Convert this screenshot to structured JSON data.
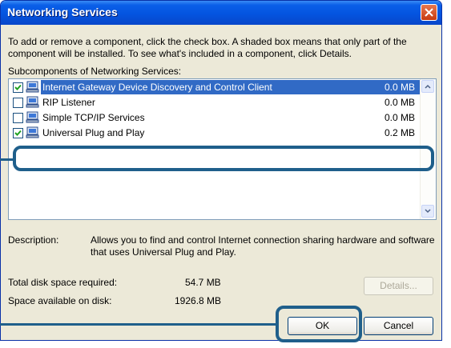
{
  "window": {
    "title": "Networking Services"
  },
  "intro_text": "To add or remove a component, click the check box. A shaded box means that only part of the component will be installed. To see what's included in a component, click Details.",
  "subcomponents_label": "Subcomponents of Networking Services:",
  "components": [
    {
      "name": "Internet Gateway Device Discovery and Control Client",
      "size": "0.0 MB",
      "checked": true,
      "selected": true
    },
    {
      "name": "RIP Listener",
      "size": "0.0 MB",
      "checked": false,
      "selected": false
    },
    {
      "name": "Simple TCP/IP Services",
      "size": "0.0 MB",
      "checked": false,
      "selected": false
    },
    {
      "name": "Universal Plug and Play",
      "size": "0.2 MB",
      "checked": true,
      "selected": false
    }
  ],
  "description": {
    "label": "Description:",
    "text": "Allows you to find and control Internet connection sharing hardware and software that uses Universal Plug and Play."
  },
  "disk": {
    "required_label": "Total disk space required:",
    "required_value": "54.7 MB",
    "available_label": "Space available on disk:",
    "available_value": "1926.8 MB"
  },
  "buttons": {
    "details": "Details...",
    "ok": "OK",
    "cancel": "Cancel"
  },
  "colors": {
    "titlebar": "#0454e0",
    "selection": "#316ac5",
    "callout": "#1f5f8b",
    "dialog_bg": "#ece9d8"
  },
  "icons": {
    "close": "close-icon",
    "component": "network-component-icon"
  }
}
